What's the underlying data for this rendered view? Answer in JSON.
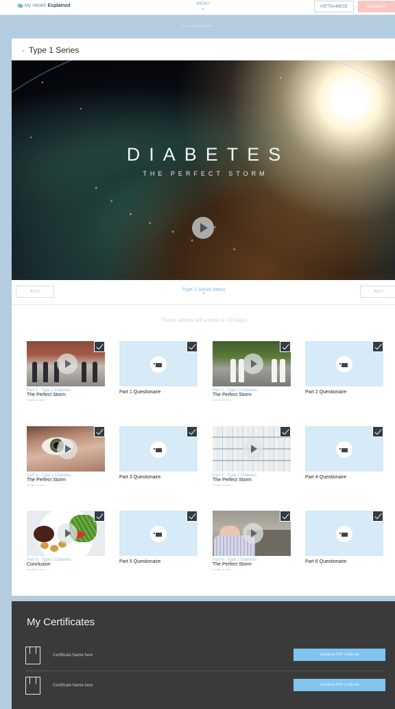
{
  "header": {
    "logo_prefix": "My Health",
    "logo_bold": "Explained",
    "menu_label": "MENU",
    "language_button": "VIETNAMESE",
    "logout_button": "LOGOUT",
    "logout_color": "#f9c7c2"
  },
  "subbar": {
    "label": "MY COURSES HERE"
  },
  "series": {
    "title": "Type 1 Series",
    "hero_title": "DIABETES",
    "hero_subtitle": "THE PERFECT STORM",
    "nav_prev": "BACK",
    "nav_next": "NEXT",
    "menu_label": "Type 2 Series Menu",
    "expiry_note": "These videos will expire in 30 Days",
    "accent_color": "#80c4ef"
  },
  "videos": [
    {
      "part": "Part 1 - Type 2 Diabetes",
      "name": "The Perfect Storm",
      "duration": "Duration 30 mins"
    },
    {
      "part": "Part 2 - Type 2 Diabetes",
      "name": "The Perfect Storm",
      "duration": "Duration 30 mins"
    },
    {
      "part": "Part 3 - Type 2 Diabetes",
      "name": "The Perfect Storm",
      "duration": "Duration 30 mins"
    },
    {
      "part": "Part 4 - Type 2 Diabetes",
      "name": "The Perfect Storm",
      "duration": "Duration 30 mins"
    },
    {
      "part": "Part 5 - Type 2 Diabetes",
      "name": "Conclusion",
      "duration": "Duration 30 mins"
    },
    {
      "part": "Part 6 - Type 2 Diabetes",
      "name": "The Perfect Storm",
      "duration": "Duration 30 mins"
    }
  ],
  "questionnaires": [
    {
      "name": "Part 1 Questionaire"
    },
    {
      "name": "Part 2 Questionaire"
    },
    {
      "name": "Part 3 Questionaire"
    },
    {
      "name": "Part 4 Questionaire"
    },
    {
      "name": "Part 5 Questionaire"
    },
    {
      "name": "Part 6 Questionaire"
    }
  ],
  "certificates": {
    "title": "My Certificates",
    "items": [
      {
        "name": "Certificate Name here",
        "button": "Download PDF Certificate"
      },
      {
        "name": "Certificate Name here",
        "button": "Download PDF Certificate"
      }
    ]
  }
}
